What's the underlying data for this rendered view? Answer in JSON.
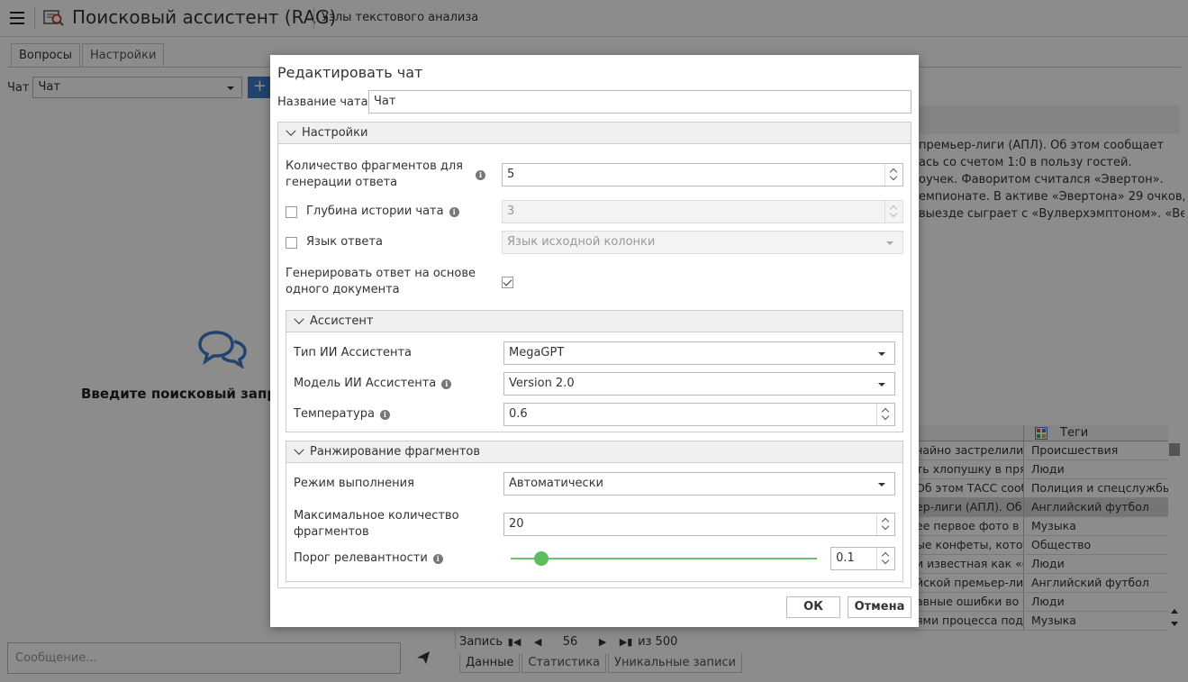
{
  "app": {
    "title": "Поисковый ассистент (RAG)",
    "subtitle": "Узлы текстового анализа"
  },
  "tabs_top": [
    "Вопросы",
    "Настройки"
  ],
  "chat_select": {
    "label": "Чат",
    "value": "Чат",
    "add": "+"
  },
  "empty_state": "Введите поисковый запрос",
  "message_placeholder": "Сообщение...",
  "article_lines": [
    "премьер-лиги (АПЛ). Об этом сообщает",
    "ась со счетом 1:0 в пользу гостей.",
    "оучек. Фаворитом считался «Эвертон».",
    "емпионате. В активе «Эвертона» 29 очков,",
    "выезде сыграет с «Вулверхэмптоном». «Вест"
  ],
  "grid": {
    "tags_header": "Теги",
    "rows": [
      {
        "text": "чайно застрелили и",
        "tag": "Происшествия"
      },
      {
        "text": "ть хлопушку в прям",
        "tag": "Люди"
      },
      {
        "text": "Об этом ТАСС сооб",
        "tag": "Полиция и спецслужбы"
      },
      {
        "text": "ер-лиги (АПЛ). Об эт",
        "tag": "Английский футбол",
        "selected": true
      },
      {
        "text": "ее первое фото в Ins",
        "tag": "Музыка"
      },
      {
        "text": "ые конфеты, которы",
        "tag": "Общество"
      },
      {
        "text": "и известная как «са",
        "tag": "Люди"
      },
      {
        "text": "йской премьер-лиг",
        "tag": "Английский футбол"
      },
      {
        "text": "авные ошибки во в",
        "tag": "Люди"
      },
      {
        "text": "ями процесса подел",
        "tag": "Музыка"
      }
    ]
  },
  "pager": {
    "label": "Запись",
    "current": "56",
    "total": "из 500"
  },
  "tabs_bottom": [
    "Данные",
    "Статистика",
    "Уникальные записи"
  ],
  "dialog": {
    "title": "Редактировать чат",
    "name_label": "Название чата",
    "name_value": "Чат",
    "settings_header": "Настройки",
    "fragments_label": "Количество фрагментов для генерации ответа",
    "fragments_value": "5",
    "history_label": "Глубина истории чата",
    "history_value": "3",
    "history_checked": false,
    "lang_label": "Язык ответа",
    "lang_value": "Язык исходной колонки",
    "lang_checked": false,
    "single_doc_label": "Генерировать ответ на основе одного документа",
    "single_doc_checked": true,
    "assistant_header": "Ассистент",
    "ai_type_label": "Тип ИИ Ассистента",
    "ai_type_value": "MegaGPT",
    "ai_model_label": "Модель ИИ Ассистента",
    "ai_model_value": "Version 2.0",
    "temperature_label": "Температура",
    "temperature_value": "0.6",
    "ranking_header": "Ранжирование фрагментов",
    "mode_label": "Режим выполнения",
    "mode_value": "Автоматически",
    "max_fragments_label": "Максимальное количество фрагментов",
    "max_fragments_value": "20",
    "threshold_label": "Порог релевантности",
    "threshold_value": "0.1",
    "ok": "ОК",
    "cancel": "Отмена"
  },
  "colors": {
    "accent": "#3c7bc7",
    "slider": "#5cbd5c"
  }
}
